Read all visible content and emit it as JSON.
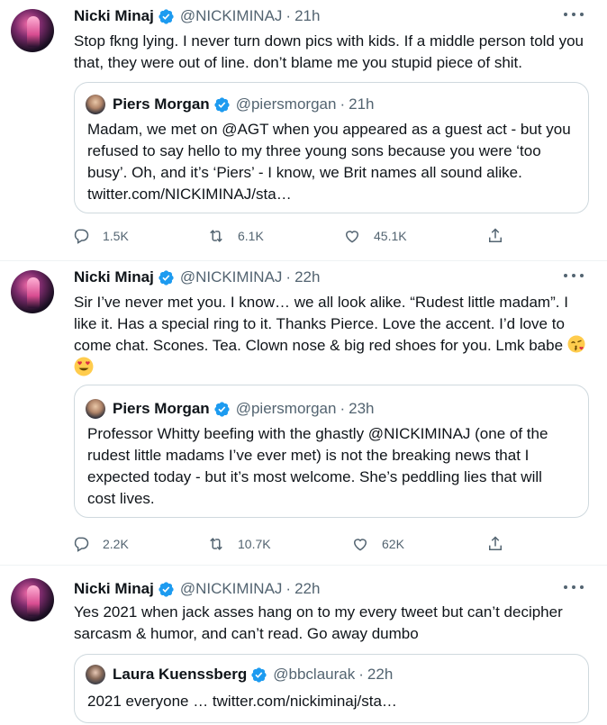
{
  "tweets": [
    {
      "author": {
        "name": "Nicki Minaj",
        "handle": "@NICKIMINAJ",
        "time": "21h"
      },
      "text_lines": [
        "Stop fkng lying. I never turn down pics with kids. If a middle person told you",
        "that, they were out of line.  don’t blame me you stupid piece of shit."
      ],
      "quote": {
        "author": {
          "name": "Piers Morgan",
          "handle": "@piersmorgan",
          "time": "21h"
        },
        "text_lines": [
          "Madam, we met on @AGT when you appeared as a guest act - but you",
          "refused to say hello to my three young sons because you were ‘too",
          "busy’. Oh, and it’s ‘Piers’ - I know, we Brit names all sound alike.",
          "twitter.com/NICKIMINAJ/sta…"
        ]
      },
      "metrics": {
        "replies": "1.5K",
        "retweets": "6.1K",
        "likes": "45.1K"
      }
    },
    {
      "author": {
        "name": "Nicki Minaj",
        "handle": "@NICKIMINAJ",
        "time": "22h"
      },
      "text_lines": [
        "Sir I’ve never met you. I know… we all look alike. “Rudest little madam”. I",
        "like it. Has a special ring to it. Thanks Pierce. Love the accent. I’d love to",
        "come chat. Scones. Tea. Clown nose & big red shoes for you. Lmk babe"
      ],
      "emoji_inline": "kissing-heart-emoji",
      "emoji_next_line": "heart-eyes-emoji",
      "quote": {
        "author": {
          "name": "Piers Morgan",
          "handle": "@piersmorgan",
          "time": "23h"
        },
        "text_lines": [
          "Professor Whitty beefing with the ghastly @NICKIMINAJ (one of the",
          "rudest little madams I’ve ever met) is not the breaking news that I",
          "expected today - but it’s most welcome. She’s peddling lies that will",
          "cost lives."
        ]
      },
      "metrics": {
        "replies": "2.2K",
        "retweets": "10.7K",
        "likes": "62K"
      }
    },
    {
      "author": {
        "name": "Nicki Minaj",
        "handle": "@NICKIMINAJ",
        "time": "22h"
      },
      "text_lines": [
        "Yes 2021 when jack asses hang on to my every tweet but can’t decipher",
        "sarcasm & humor, and can’t read. Go away dumbo"
      ],
      "quote": {
        "author": {
          "name": "Laura Kuenssberg",
          "handle": "@bbclaurak",
          "time": "22h"
        },
        "text_lines": [
          "2021 everyone … twitter.com/nickiminaj/sta…"
        ]
      }
    }
  ],
  "dot_separator": "·",
  "icons": {
    "verified": "verified-badge-icon",
    "more": "more-options-icon",
    "reply": "reply-icon",
    "retweet": "retweet-icon",
    "like": "like-icon",
    "share": "share-icon"
  },
  "colors": {
    "verified": "#1d9bf0",
    "text": "#0f1419",
    "muted": "#536471",
    "border": "#cfd9de"
  }
}
